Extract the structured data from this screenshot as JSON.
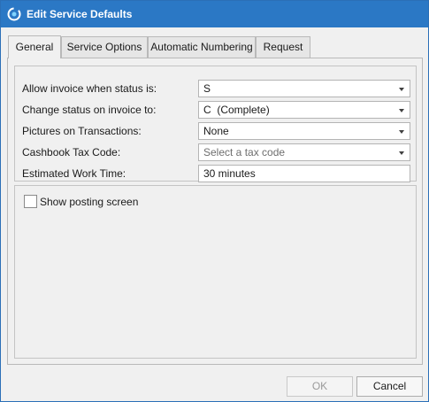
{
  "window": {
    "title": "Edit Service Defaults",
    "icon": "app-logo-icon",
    "colors": {
      "titlebar": "#2b78c5",
      "background": "#f0f0f0"
    }
  },
  "tabs": [
    {
      "label": "General",
      "active": true
    },
    {
      "label": "Service Options",
      "active": false
    },
    {
      "label": "Automatic Numbering",
      "active": false
    },
    {
      "label": "Request",
      "active": false
    }
  ],
  "fields": {
    "allow_invoice": {
      "label": "Allow invoice when status is:",
      "value": "S"
    },
    "change_status": {
      "label": "Change status on invoice to:",
      "value": "C  (Complete)"
    },
    "pictures": {
      "label": "Pictures on Transactions:",
      "value": "None"
    },
    "cashbook_tax": {
      "label": "Cashbook Tax Code:",
      "placeholder": "Select a tax code"
    },
    "work_time": {
      "label": "Estimated Work Time:",
      "value": "30 minutes"
    }
  },
  "options": {
    "show_posting": {
      "label": "Show posting screen",
      "checked": false
    }
  },
  "buttons": {
    "ok": {
      "label": "OK",
      "enabled": false
    },
    "cancel": {
      "label": "Cancel",
      "enabled": true
    }
  }
}
